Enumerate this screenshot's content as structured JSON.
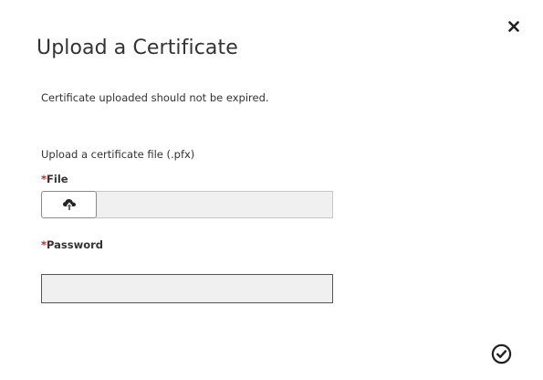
{
  "dialog": {
    "title": "Upload a Certificate",
    "note": "Certificate uploaded should not be expired.",
    "section_label": "Upload a certificate file (.pfx)",
    "file_field": {
      "required_marker": "*",
      "label": "File",
      "value": ""
    },
    "password_field": {
      "required_marker": "*",
      "label": "Password",
      "value": "",
      "placeholder": ""
    }
  },
  "icons": {
    "close": "close-icon",
    "upload": "cloud-upload-icon",
    "confirm": "check-circle-icon"
  },
  "colors": {
    "text": "#333333",
    "required": "#c62828",
    "input_background": "#f0f0f0"
  }
}
